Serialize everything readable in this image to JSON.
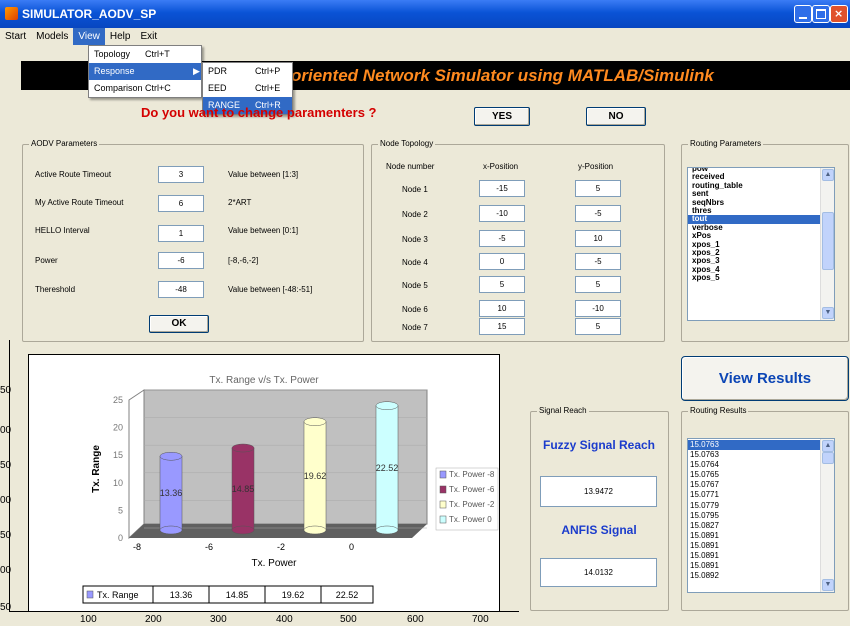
{
  "window": {
    "title": "SIMULATOR_AODV_SP"
  },
  "menubar": [
    "Start",
    "Models",
    "View",
    "Help",
    "Exit"
  ],
  "view_menu": [
    {
      "label": "Topology",
      "shortcut": "Ctrl+T"
    },
    {
      "label": "Response",
      "shortcut": "▶"
    },
    {
      "label": "Comparison",
      "shortcut": "Ctrl+C"
    }
  ],
  "response_submenu": [
    {
      "label": "PDR",
      "shortcut": "Ctrl+P"
    },
    {
      "label": "EED",
      "shortcut": "Ctrl+E"
    },
    {
      "label": "RANGE",
      "shortcut": "Ctrl+R"
    }
  ],
  "banner": "oriented Network Simulator using MATLAB/Simulink",
  "question": "Do you want to change paramenters ?",
  "yes_label": "YES",
  "no_label": "NO",
  "aodv": {
    "title": "AODV Parameters",
    "rows": [
      {
        "label": "Active Route Timeout",
        "value": "3",
        "hint": "Value between [1:3]"
      },
      {
        "label": "My Active Route Timeout",
        "value": "6",
        "hint": "2*ART"
      },
      {
        "label": "HELLO Interval",
        "value": "1",
        "hint": "Value between [0:1]"
      },
      {
        "label": "Power",
        "value": "-6",
        "hint": "[-8,-6,-2]"
      },
      {
        "label": "Thereshold",
        "value": "-48",
        "hint": "Value between [-48:-51]"
      }
    ],
    "ok_label": "OK"
  },
  "topology": {
    "title": "Node Topology",
    "headers": [
      "Node number",
      "x-Position",
      "y-Position"
    ],
    "rows": [
      {
        "node": "Node 1",
        "x": "-15",
        "y": "5"
      },
      {
        "node": "Node 2",
        "x": "-10",
        "y": "-5"
      },
      {
        "node": "Node 3",
        "x": "-5",
        "y": "10"
      },
      {
        "node": "Node 4",
        "x": "0",
        "y": "-5"
      },
      {
        "node": "Node 5",
        "x": "5",
        "y": "5"
      },
      {
        "node": "Node 6",
        "x": "10",
        "y": "-10"
      },
      {
        "node": "Node 7",
        "x": "15",
        "y": "5"
      }
    ]
  },
  "routing_params": {
    "title": "Routing Parameters",
    "items": [
      "pow",
      "received",
      "routing_table",
      "sent",
      "seqNbrs",
      "thres",
      "tout",
      "verbose",
      "xPos",
      "xpos_1",
      "xpos_2",
      "xpos_3",
      "xpos_4",
      "xpos_5"
    ],
    "selected": "tout"
  },
  "view_results_label": "View Results",
  "signal_reach": {
    "title": "Signal Reach",
    "fuzzy_label": "Fuzzy Signal Reach",
    "fuzzy_value": "13.9472",
    "anfis_label": "ANFIS Signal",
    "anfis_value": "14.0132"
  },
  "routing_results": {
    "title": "Routing Results",
    "items": [
      "15.0763",
      "15.0763",
      "15.0764",
      "15.0765",
      "15.0767",
      "15.0771",
      "15.0779",
      "15.0795",
      "15.0827",
      "15.0891",
      "15.0891",
      "15.0891",
      "15.0891",
      "15.0892"
    ]
  },
  "axes": {
    "y_ticks": [
      "50",
      "00",
      "50",
      "00",
      "50",
      "00",
      "50"
    ],
    "x_ticks": [
      "100",
      "200",
      "300",
      "400",
      "500",
      "600",
      "700"
    ]
  },
  "chart_data": {
    "type": "bar",
    "title": "Tx. Range v/s Tx. Power",
    "xlabel": "Tx. Power",
    "ylabel": "Tx. Range",
    "categories": [
      "-8",
      "-6",
      "-2",
      "0"
    ],
    "values": [
      13.36,
      14.85,
      19.62,
      22.52
    ],
    "ylim": [
      0,
      25
    ],
    "y_ticks": [
      "25",
      "20",
      "15",
      "10",
      "5",
      "0"
    ],
    "legend": [
      "Tx. Power -8",
      "Tx. Power -6",
      "Tx. Power -2",
      "Tx. Power 0"
    ],
    "legend_position": "right",
    "colors": [
      "#9999ff",
      "#993366",
      "#ffffcc",
      "#ccffff"
    ],
    "data_table": {
      "row_label": "Tx. Range",
      "values": [
        "13.36",
        "14.85",
        "19.62",
        "22.52"
      ]
    }
  }
}
